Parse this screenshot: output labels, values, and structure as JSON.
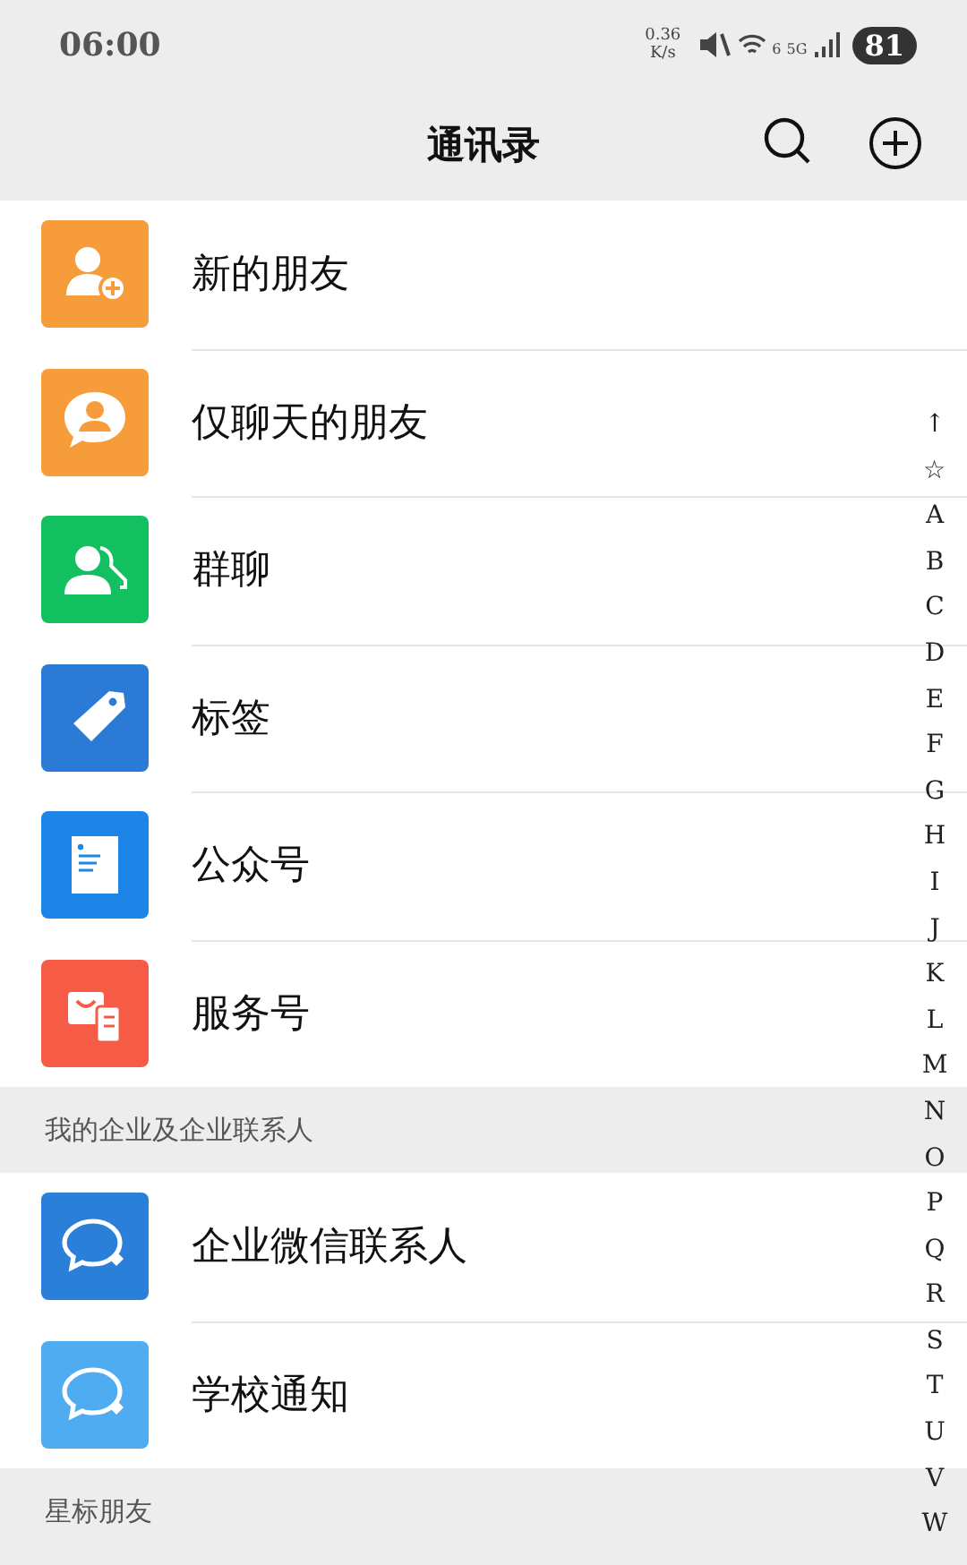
{
  "status_bar": {
    "time": "06:00",
    "net_speed": "0.36",
    "net_unit": "K/s",
    "wifi_badge": "6",
    "cell_badge": "5G",
    "battery": "81"
  },
  "header": {
    "title": "通讯录"
  },
  "sections": [
    {
      "items": [
        {
          "kind": "add_friend",
          "label": "新的朋友"
        },
        {
          "kind": "chat_only",
          "label": "仅聊天的朋友"
        },
        {
          "kind": "group",
          "label": "群聊"
        },
        {
          "kind": "tag",
          "label": "标签"
        },
        {
          "kind": "official",
          "label": "公众号"
        },
        {
          "kind": "service",
          "label": "服务号"
        }
      ]
    },
    {
      "heading": "我的企业及企业联系人",
      "items": [
        {
          "kind": "work",
          "label": "企业微信联系人"
        },
        {
          "kind": "school",
          "label": "学校通知"
        }
      ]
    },
    {
      "heading": "星标朋友"
    }
  ],
  "index_bar": [
    "↑",
    "☆",
    "A",
    "B",
    "C",
    "D",
    "E",
    "F",
    "G",
    "H",
    "I",
    "J",
    "K",
    "L",
    "M",
    "N",
    "O",
    "P",
    "Q",
    "R",
    "S",
    "T",
    "U",
    "V",
    "W"
  ]
}
